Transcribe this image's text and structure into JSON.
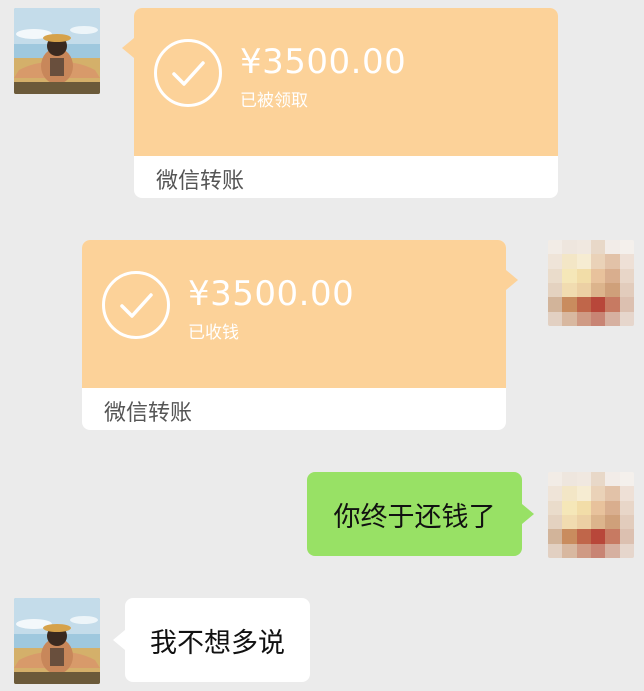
{
  "colors": {
    "background": "#ebebeb",
    "transfer_card": "#fcd299",
    "sent_bubble": "#98e165",
    "received_bubble": "#ffffff"
  },
  "messages": [
    {
      "type": "transfer",
      "sender": "contact",
      "amount": "¥3500.00",
      "status": "已被领取",
      "label": "微信转账",
      "icon": "check-circle-icon"
    },
    {
      "type": "transfer",
      "sender": "me",
      "amount": "¥3500.00",
      "status": "已收钱",
      "label": "微信转账",
      "icon": "check-circle-icon"
    },
    {
      "type": "text",
      "sender": "me",
      "text": "你终于还钱了"
    },
    {
      "type": "text",
      "sender": "contact",
      "text": "我不想多说"
    }
  ]
}
